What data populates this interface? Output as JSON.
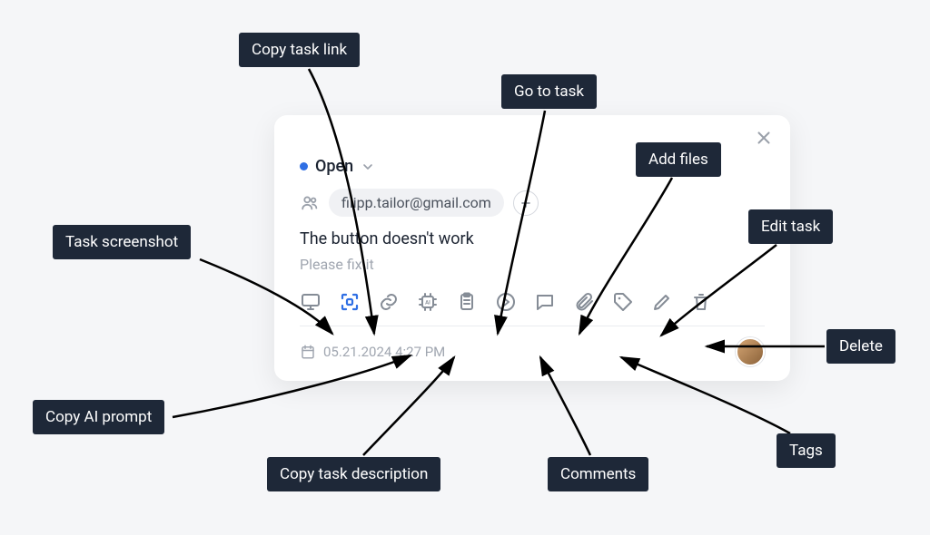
{
  "card": {
    "status_label": "Open",
    "email": "filipp.tailor@gmail.com",
    "task_title": "The button doesn't work",
    "task_description": "Please fix it",
    "timestamp": "05.21.2024 4:27 PM"
  },
  "callouts": {
    "task_screenshot": "Task screenshot",
    "copy_task_link": "Copy task link",
    "go_to_task": "Go to task",
    "add_files": "Add files",
    "edit_task": "Edit task",
    "delete": "Delete",
    "tags": "Tags",
    "comments": "Comments",
    "copy_task_description": "Copy task description",
    "copy_ai_prompt": "Copy AI prompt"
  },
  "toolbar_items": [
    "monitor-icon",
    "capture-icon",
    "link-icon",
    "ai-chip-icon",
    "clipboard-icon",
    "goto-icon",
    "comment-icon",
    "attachment-icon",
    "tag-icon",
    "edit-icon",
    "delete-icon"
  ]
}
